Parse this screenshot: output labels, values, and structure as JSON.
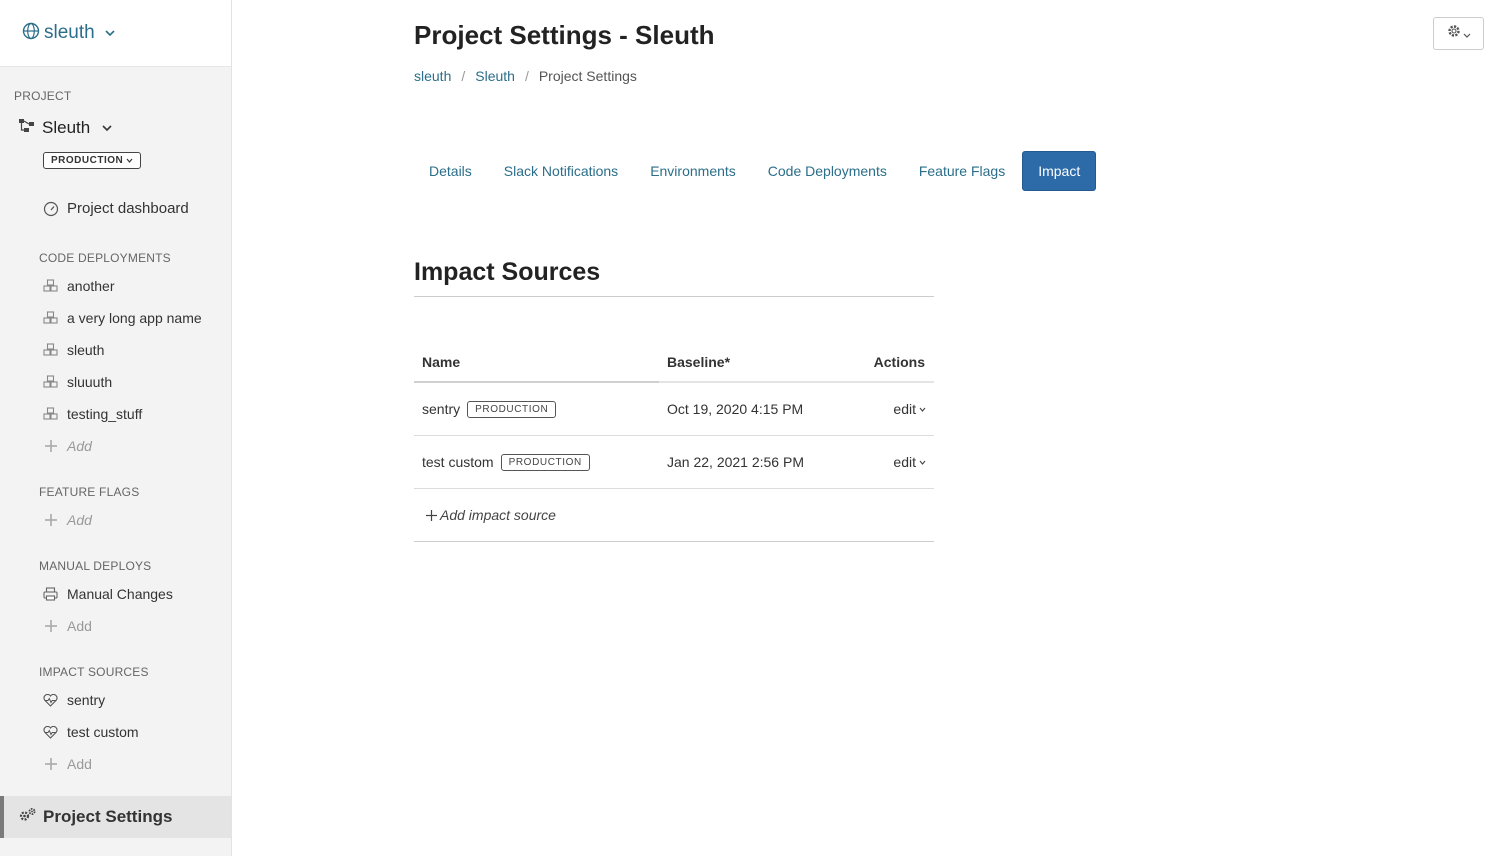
{
  "sidebar": {
    "org_name": "sleuth",
    "project_label": "PROJECT",
    "project_name": "Sleuth",
    "environment": "PRODUCTION",
    "dashboard": "Project dashboard",
    "code_deployments": {
      "label": "CODE DEPLOYMENTS",
      "items": [
        "another",
        "a very long app name",
        "sleuth",
        "sluuuth",
        "testing_stuff"
      ],
      "add": "Add"
    },
    "feature_flags": {
      "label": "FEATURE FLAGS",
      "add": "Add"
    },
    "manual_deploys": {
      "label": "MANUAL DEPLOYS",
      "items": [
        "Manual Changes"
      ],
      "add": "Add"
    },
    "impact_sources": {
      "label": "IMPACT SOURCES",
      "items": [
        "sentry",
        "test custom"
      ],
      "add": "Add"
    },
    "settings": "Project Settings"
  },
  "header": {
    "title": "Project Settings - Sleuth",
    "breadcrumb": [
      "sleuth",
      "Sleuth",
      "Project Settings"
    ]
  },
  "tabs": [
    {
      "label": "Details",
      "active": false
    },
    {
      "label": "Slack Notifications",
      "active": false
    },
    {
      "label": "Environments",
      "active": false
    },
    {
      "label": "Code Deployments",
      "active": false
    },
    {
      "label": "Feature Flags",
      "active": false
    },
    {
      "label": "Impact",
      "active": true
    }
  ],
  "impact": {
    "section_title": "Impact Sources",
    "columns": [
      "Name",
      "Baseline*",
      "Actions"
    ],
    "rows": [
      {
        "name": "sentry",
        "badge": "PRODUCTION",
        "baseline": "Oct 19, 2020 4:15 PM",
        "action": "edit"
      },
      {
        "name": "test custom",
        "badge": "PRODUCTION",
        "baseline": "Jan 22, 2021 2:56 PM",
        "action": "edit"
      }
    ],
    "add_label": "Add impact source"
  },
  "colors": {
    "link": "#2b6e8a",
    "active_tab": "#2c6aa8",
    "sidebar_bg": "#f3f3f3"
  }
}
